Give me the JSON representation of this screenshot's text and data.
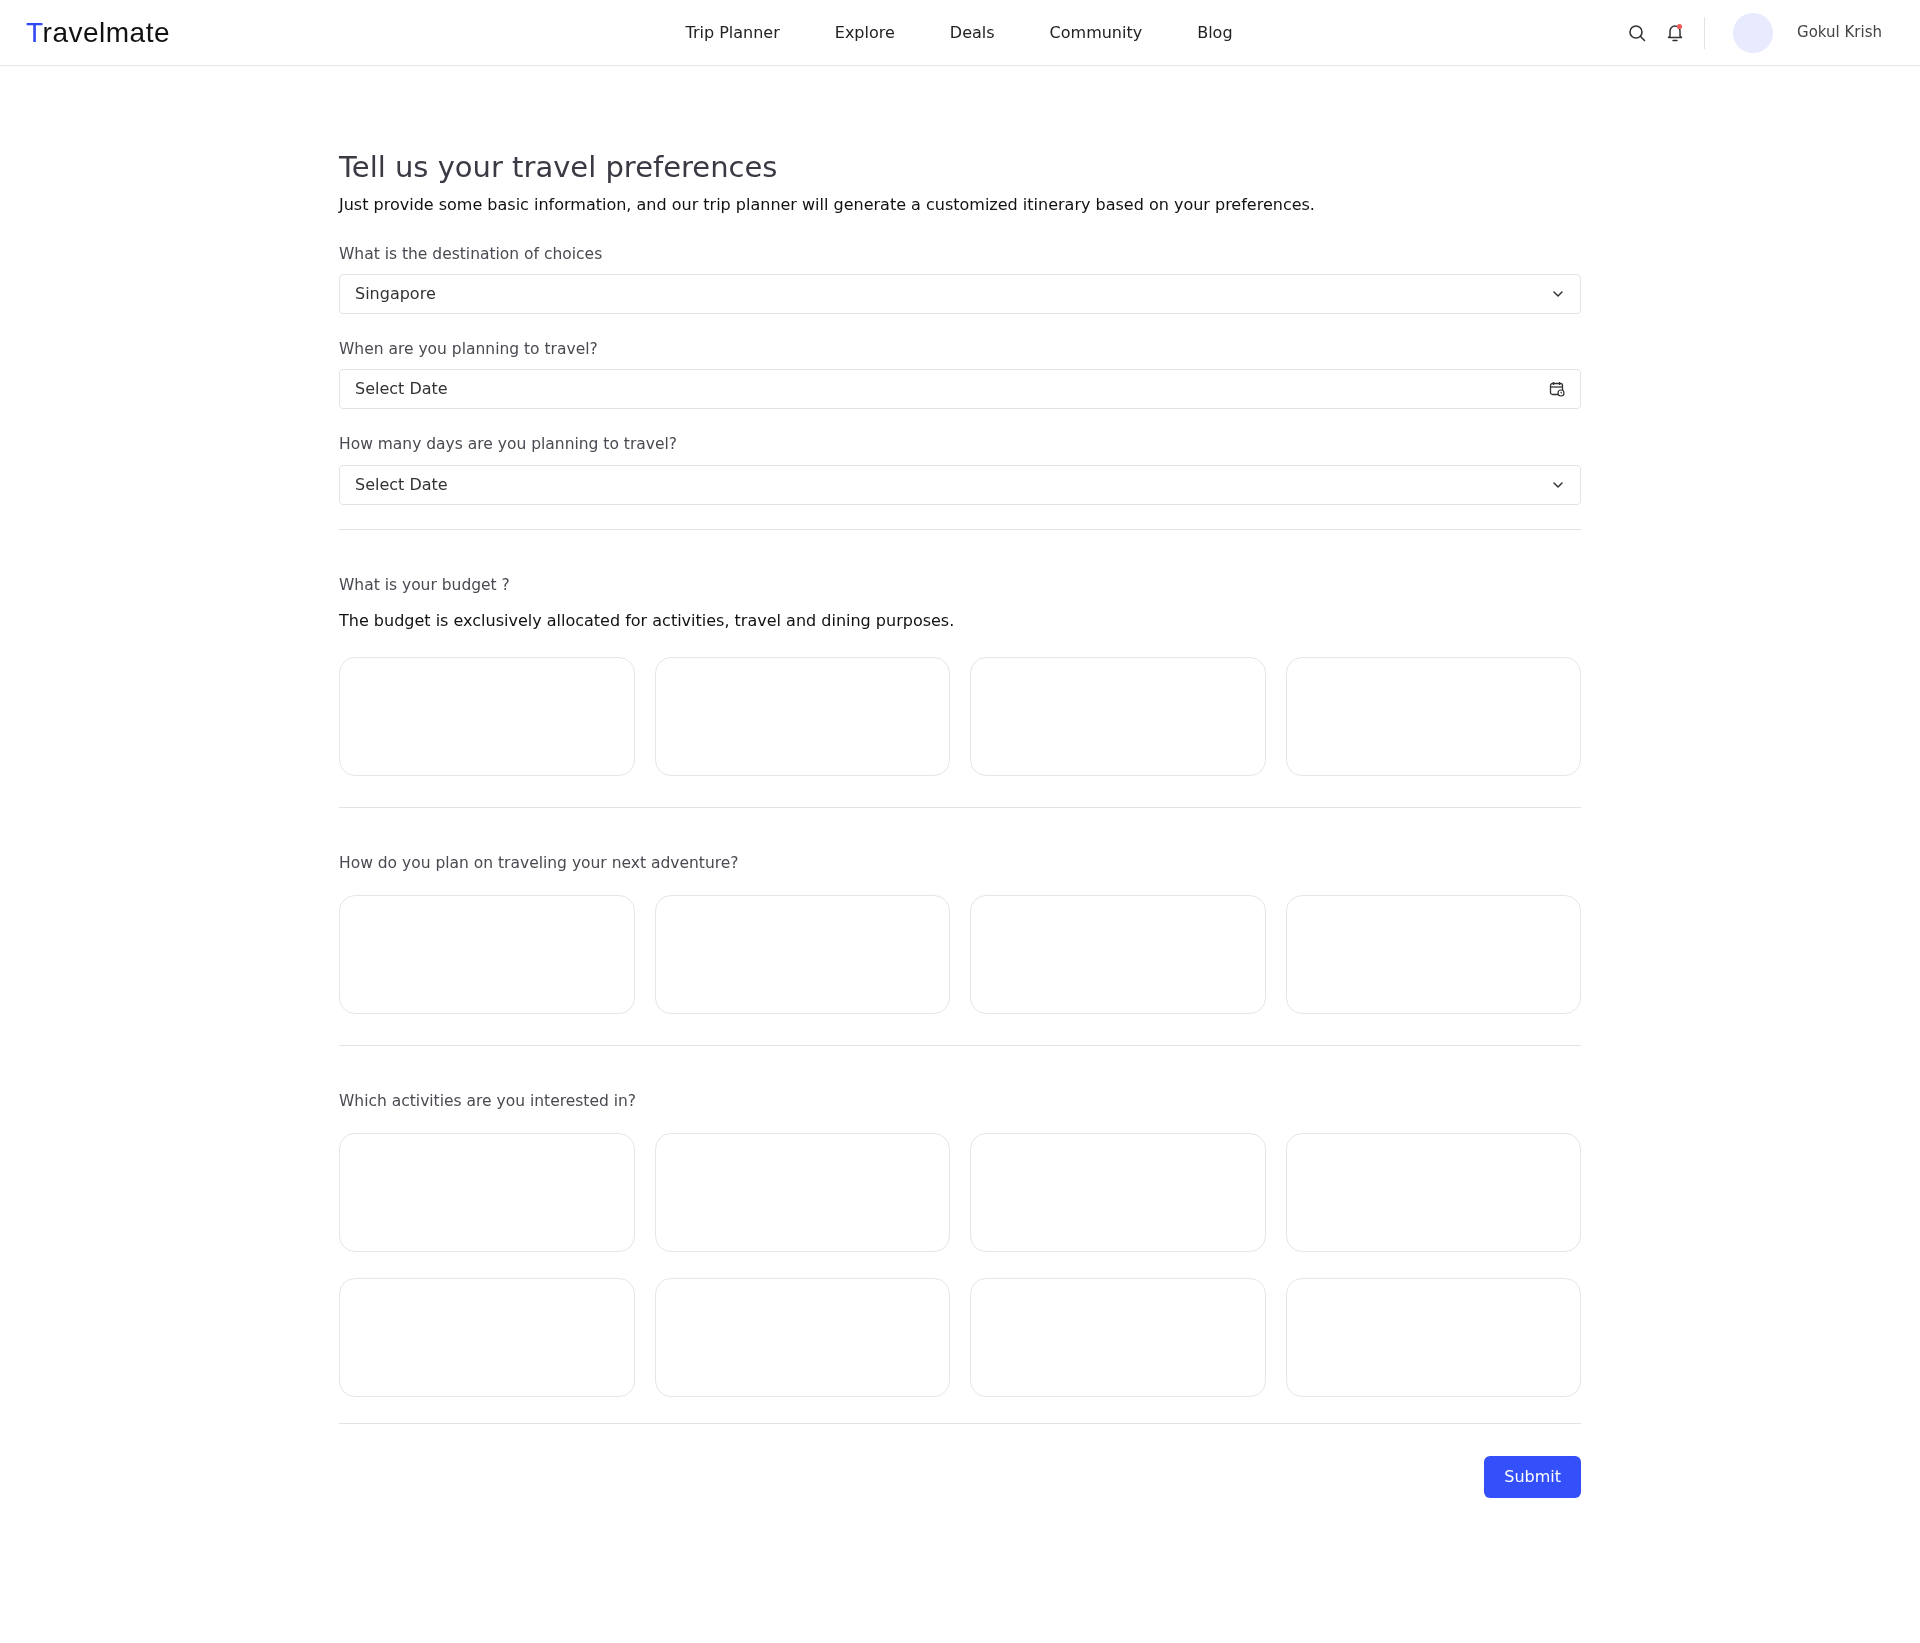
{
  "header": {
    "logo": {
      "accent": "T",
      "rest": "ravelmate"
    },
    "nav": [
      {
        "label": "Trip Planner"
      },
      {
        "label": "Explore"
      },
      {
        "label": "Deals"
      },
      {
        "label": "Community"
      },
      {
        "label": "Blog"
      }
    ],
    "notification_unread": true,
    "user": {
      "name": "Gokul Krish"
    }
  },
  "form": {
    "title": "Tell us your travel preferences",
    "intro": "Just provide some basic information, and our trip planner will generate a customized itinerary based on your preferences.",
    "fields": [
      {
        "kind": "select",
        "label": "What is the destination of choices",
        "value": "Singapore"
      },
      {
        "kind": "date",
        "label": "When are you planning to travel?",
        "placeholder": "Select Date"
      },
      {
        "kind": "select",
        "label": "How many days are you planning to travel?",
        "placeholder": "Select Date"
      }
    ],
    "sections": [
      {
        "label": "What is your budget ?",
        "note": "The budget is exclusively allocated for activities, travel and dining purposes.",
        "options": [
          {
            "kind": "blank"
          },
          {
            "kind": "blank"
          },
          {
            "kind": "blank"
          },
          {
            "kind": "blank"
          }
        ]
      },
      {
        "label": "How do you plan on traveling your next adventure?",
        "options": [
          {
            "kind": "blank"
          },
          {
            "kind": "blank"
          },
          {
            "kind": "blank"
          },
          {
            "kind": "blank"
          }
        ]
      },
      {
        "label": "Which activities are you interested in?",
        "options": [
          {
            "kind": "blank"
          },
          {
            "kind": "blank"
          },
          {
            "kind": "blank"
          },
          {
            "kind": "blank"
          },
          {
            "kind": "blank"
          },
          {
            "kind": "blank"
          },
          {
            "kind": "blank"
          },
          {
            "kind": "blank"
          }
        ]
      }
    ],
    "submit": "Submit"
  }
}
